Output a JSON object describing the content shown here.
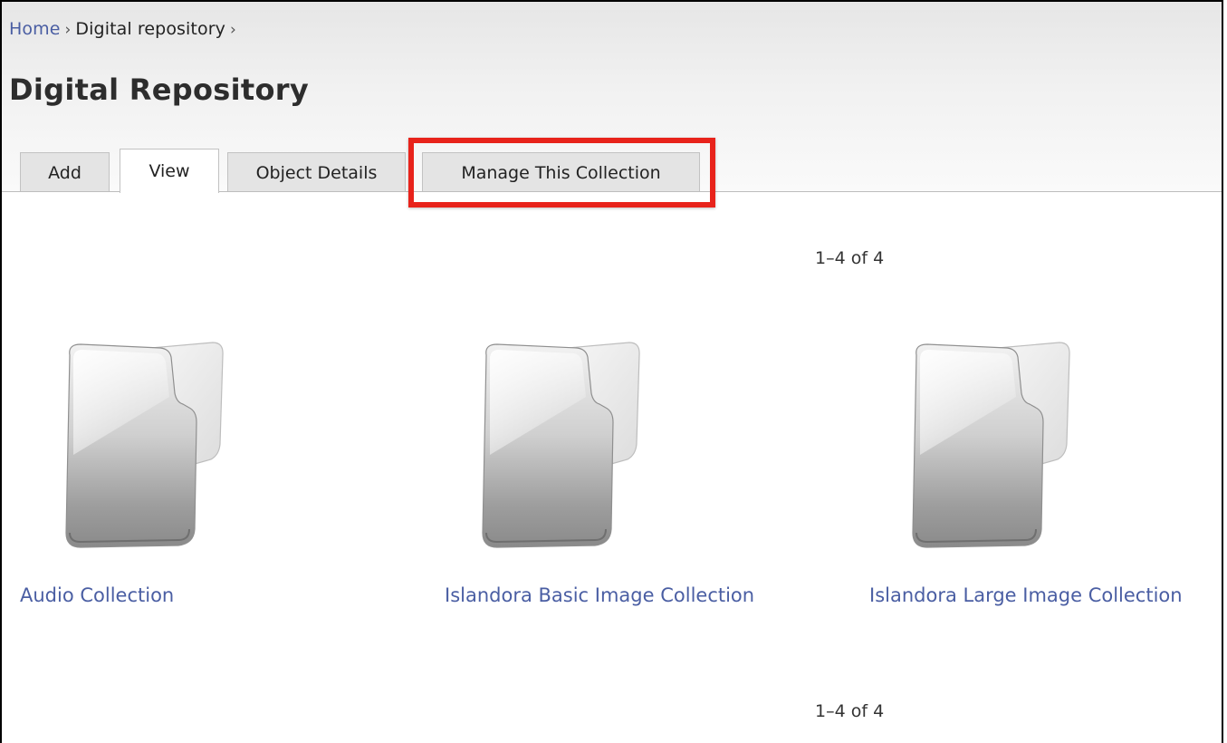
{
  "breadcrumb": {
    "home": "Home",
    "separator": "›",
    "current": "Digital repository"
  },
  "page_title": "Digital Repository",
  "tabs": [
    {
      "label": "Add",
      "active": false
    },
    {
      "label": "View",
      "active": true
    },
    {
      "label": "Object Details",
      "active": false
    },
    {
      "label": "Manage This Collection",
      "active": false
    }
  ],
  "pager": {
    "top": "1–4 of 4",
    "bottom": "1–4 of 4"
  },
  "collections": [
    {
      "label": "Audio Collection",
      "icon": "folder-icon"
    },
    {
      "label": "Islandora Basic Image Collection",
      "icon": "folder-icon"
    },
    {
      "label": "Islandora Large Image Collection",
      "icon": "folder-icon"
    }
  ],
  "colors": {
    "link": "#4a5ea3",
    "highlight": "#e8231b"
  }
}
